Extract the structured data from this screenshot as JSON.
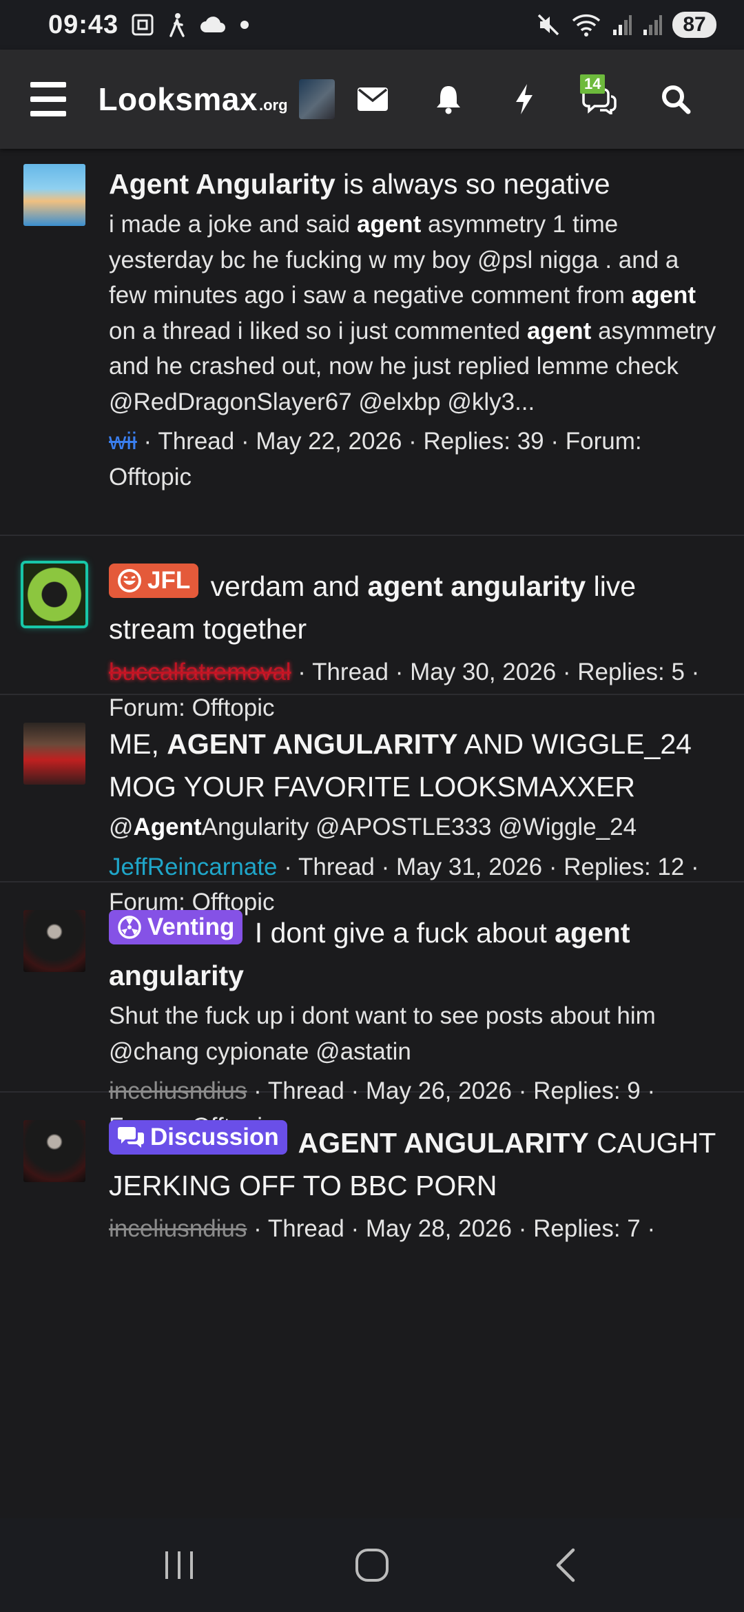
{
  "status_bar": {
    "time": "09:43",
    "battery": "87",
    "icons": [
      "screenshot-icon",
      "walking-icon",
      "cloud-icon",
      "dot-icon",
      "mute-icon",
      "wifi-icon",
      "signal-icon",
      "signal-icon"
    ]
  },
  "header": {
    "logo_main": "Looksmax",
    "logo_org": ".org",
    "conversations_badge": "14",
    "icons": [
      "menu-icon",
      "envelope-icon",
      "bell-icon",
      "bolt-icon",
      "chat-icon",
      "search-icon"
    ]
  },
  "results": [
    {
      "title_parts": {
        "b1": "Agent Angularity",
        "t1": " is always so negative"
      },
      "snippet_parts": {
        "t1": "i made a joke and said ",
        "b1": "agent",
        "t2": " asymmetry 1 time yesterday bc he fucking w my boy @psl nigga . and a few minutes ago i saw a negative comment from ",
        "b2": "agent",
        "t3": " on a thread i liked so i just commented ",
        "b3": "agent",
        "t4": " asymmetry and he crashed out, now he just replied lemme check @RedDragonSlayer67 @elxbp @kly3..."
      },
      "author": "wii",
      "type": "Thread",
      "date": "May 22, 2026",
      "replies": "Replies: 39",
      "forum": "Forum: Offtopic"
    },
    {
      "label": "JFL",
      "title_parts": {
        "t1": " verdam and ",
        "b1": "agent angularity",
        "t2": " live stream together"
      },
      "author": "buccalfatremoval",
      "type": "Thread",
      "date": "May 30, 2026",
      "replies": "Replies: 5",
      "forum": "Forum: Offtopic"
    },
    {
      "title_parts": {
        "t1": "ME, ",
        "b1": "AGENT ANGULARITY",
        "t2": " AND WIGGLE_24 MOG YOUR FAVORITE LOOKSMAXXER"
      },
      "snippet_parts": {
        "t1": "@",
        "b1": "Agent",
        "t2": "Angularity @APOSTLE333 @Wiggle_24"
      },
      "author": "JeffReincarnate",
      "type": "Thread",
      "date": "May 31, 2026",
      "replies": "Replies: 12",
      "forum": "Forum: Offtopic"
    },
    {
      "label": "Venting",
      "title_parts": {
        "t1": " I dont give a fuck about ",
        "b1": "agent angularity"
      },
      "snippet": "Shut the fuck up i dont want to see posts about him @chang cypionate @astatin",
      "author": "inceliusndius",
      "type": "Thread",
      "date": "May 26, 2026",
      "replies": "Replies: 9",
      "forum": "Forum: Offtopic"
    },
    {
      "label": "Discussion",
      "title_parts": {
        "b1": " AGENT ANGULARITY",
        "t1": " CAUGHT JERKING OFF TO BBC PORN"
      },
      "author": "inceliusndius",
      "type": "Thread",
      "date": "May 28, 2026",
      "replies": "Replies: 7"
    }
  ],
  "colors": {
    "background": "#1b1b1d",
    "header_bg": "#2a2a2c",
    "jfl_label": "#e45a3a",
    "venting_label": "#8552e6",
    "discussion_label": "#6a4fe8",
    "badge_green": "#6dba3c"
  },
  "nav_bar": {
    "icons": [
      "recent-apps-icon",
      "home-icon",
      "back-icon"
    ]
  }
}
